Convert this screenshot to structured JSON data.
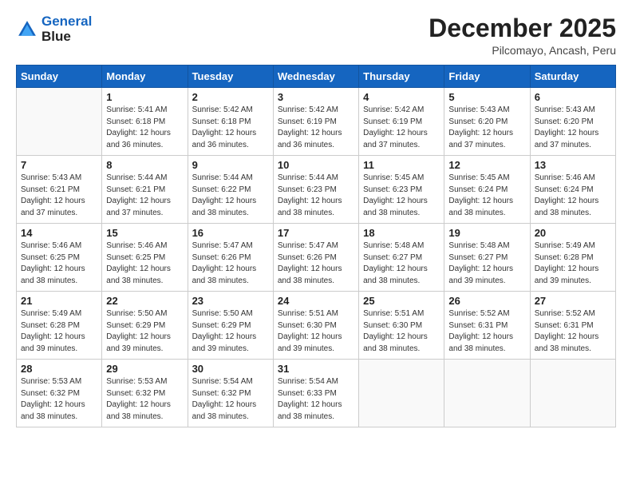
{
  "logo": {
    "line1": "General",
    "line2": "Blue"
  },
  "header": {
    "title": "December 2025",
    "subtitle": "Pilcomayo, Ancash, Peru"
  },
  "days_of_week": [
    "Sunday",
    "Monday",
    "Tuesday",
    "Wednesday",
    "Thursday",
    "Friday",
    "Saturday"
  ],
  "weeks": [
    [
      {
        "day": "",
        "info": ""
      },
      {
        "day": "1",
        "info": "Sunrise: 5:41 AM\nSunset: 6:18 PM\nDaylight: 12 hours and 36 minutes."
      },
      {
        "day": "2",
        "info": "Sunrise: 5:42 AM\nSunset: 6:18 PM\nDaylight: 12 hours and 36 minutes."
      },
      {
        "day": "3",
        "info": "Sunrise: 5:42 AM\nSunset: 6:19 PM\nDaylight: 12 hours and 36 minutes."
      },
      {
        "day": "4",
        "info": "Sunrise: 5:42 AM\nSunset: 6:19 PM\nDaylight: 12 hours and 37 minutes."
      },
      {
        "day": "5",
        "info": "Sunrise: 5:43 AM\nSunset: 6:20 PM\nDaylight: 12 hours and 37 minutes."
      },
      {
        "day": "6",
        "info": "Sunrise: 5:43 AM\nSunset: 6:20 PM\nDaylight: 12 hours and 37 minutes."
      }
    ],
    [
      {
        "day": "7",
        "info": "Sunrise: 5:43 AM\nSunset: 6:21 PM\nDaylight: 12 hours and 37 minutes."
      },
      {
        "day": "8",
        "info": "Sunrise: 5:44 AM\nSunset: 6:21 PM\nDaylight: 12 hours and 37 minutes."
      },
      {
        "day": "9",
        "info": "Sunrise: 5:44 AM\nSunset: 6:22 PM\nDaylight: 12 hours and 38 minutes."
      },
      {
        "day": "10",
        "info": "Sunrise: 5:44 AM\nSunset: 6:23 PM\nDaylight: 12 hours and 38 minutes."
      },
      {
        "day": "11",
        "info": "Sunrise: 5:45 AM\nSunset: 6:23 PM\nDaylight: 12 hours and 38 minutes."
      },
      {
        "day": "12",
        "info": "Sunrise: 5:45 AM\nSunset: 6:24 PM\nDaylight: 12 hours and 38 minutes."
      },
      {
        "day": "13",
        "info": "Sunrise: 5:46 AM\nSunset: 6:24 PM\nDaylight: 12 hours and 38 minutes."
      }
    ],
    [
      {
        "day": "14",
        "info": "Sunrise: 5:46 AM\nSunset: 6:25 PM\nDaylight: 12 hours and 38 minutes."
      },
      {
        "day": "15",
        "info": "Sunrise: 5:46 AM\nSunset: 6:25 PM\nDaylight: 12 hours and 38 minutes."
      },
      {
        "day": "16",
        "info": "Sunrise: 5:47 AM\nSunset: 6:26 PM\nDaylight: 12 hours and 38 minutes."
      },
      {
        "day": "17",
        "info": "Sunrise: 5:47 AM\nSunset: 6:26 PM\nDaylight: 12 hours and 38 minutes."
      },
      {
        "day": "18",
        "info": "Sunrise: 5:48 AM\nSunset: 6:27 PM\nDaylight: 12 hours and 38 minutes."
      },
      {
        "day": "19",
        "info": "Sunrise: 5:48 AM\nSunset: 6:27 PM\nDaylight: 12 hours and 39 minutes."
      },
      {
        "day": "20",
        "info": "Sunrise: 5:49 AM\nSunset: 6:28 PM\nDaylight: 12 hours and 39 minutes."
      }
    ],
    [
      {
        "day": "21",
        "info": "Sunrise: 5:49 AM\nSunset: 6:28 PM\nDaylight: 12 hours and 39 minutes."
      },
      {
        "day": "22",
        "info": "Sunrise: 5:50 AM\nSunset: 6:29 PM\nDaylight: 12 hours and 39 minutes."
      },
      {
        "day": "23",
        "info": "Sunrise: 5:50 AM\nSunset: 6:29 PM\nDaylight: 12 hours and 39 minutes."
      },
      {
        "day": "24",
        "info": "Sunrise: 5:51 AM\nSunset: 6:30 PM\nDaylight: 12 hours and 39 minutes."
      },
      {
        "day": "25",
        "info": "Sunrise: 5:51 AM\nSunset: 6:30 PM\nDaylight: 12 hours and 38 minutes."
      },
      {
        "day": "26",
        "info": "Sunrise: 5:52 AM\nSunset: 6:31 PM\nDaylight: 12 hours and 38 minutes."
      },
      {
        "day": "27",
        "info": "Sunrise: 5:52 AM\nSunset: 6:31 PM\nDaylight: 12 hours and 38 minutes."
      }
    ],
    [
      {
        "day": "28",
        "info": "Sunrise: 5:53 AM\nSunset: 6:32 PM\nDaylight: 12 hours and 38 minutes."
      },
      {
        "day": "29",
        "info": "Sunrise: 5:53 AM\nSunset: 6:32 PM\nDaylight: 12 hours and 38 minutes."
      },
      {
        "day": "30",
        "info": "Sunrise: 5:54 AM\nSunset: 6:32 PM\nDaylight: 12 hours and 38 minutes."
      },
      {
        "day": "31",
        "info": "Sunrise: 5:54 AM\nSunset: 6:33 PM\nDaylight: 12 hours and 38 minutes."
      },
      {
        "day": "",
        "info": ""
      },
      {
        "day": "",
        "info": ""
      },
      {
        "day": "",
        "info": ""
      }
    ]
  ]
}
